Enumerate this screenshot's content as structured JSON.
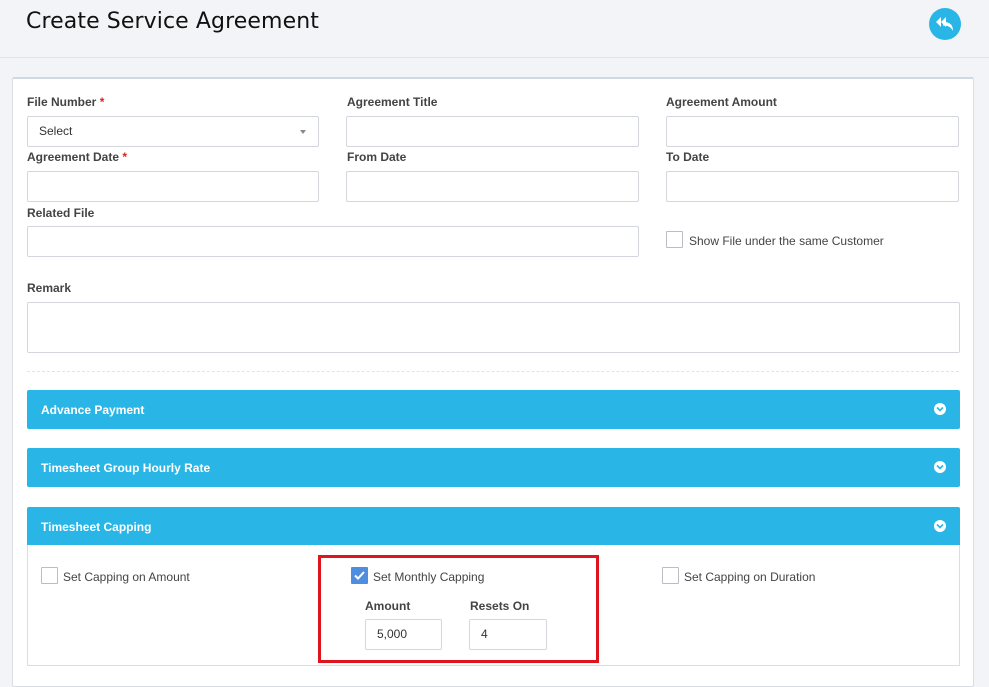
{
  "header": {
    "title": "Create Service Agreement",
    "back_icon": "reply-icon"
  },
  "form": {
    "file_number": {
      "label": "File Number",
      "required_mark": "*",
      "value": "Select"
    },
    "agreement_title": {
      "label": "Agreement Title",
      "value": ""
    },
    "agreement_amount": {
      "label": "Agreement Amount",
      "value": ""
    },
    "agreement_date": {
      "label": "Agreement Date",
      "required_mark": "*",
      "value": ""
    },
    "from_date": {
      "label": "From Date",
      "value": ""
    },
    "to_date": {
      "label": "To Date",
      "value": ""
    },
    "related_file": {
      "label": "Related File",
      "value": ""
    },
    "show_file_same_customer": {
      "label": "Show File under the same Customer",
      "checked": false
    },
    "remark": {
      "label": "Remark",
      "value": ""
    }
  },
  "sections": {
    "advance_payment": {
      "title": "Advance Payment"
    },
    "timesheet_group_hourly_rate": {
      "title": "Timesheet Group Hourly Rate"
    },
    "timesheet_capping": {
      "title": "Timesheet Capping",
      "capping_on_amount": {
        "label": "Set Capping on Amount",
        "checked": false
      },
      "monthly_capping": {
        "label": "Set Monthly Capping",
        "checked": true
      },
      "capping_on_duration": {
        "label": "Set Capping on Duration",
        "checked": false
      },
      "amount": {
        "label": "Amount",
        "value": "5,000"
      },
      "resets_on": {
        "label": "Resets On",
        "value": "4"
      }
    }
  },
  "colors": {
    "accent": "#29b6e6",
    "checkbox_checked": "#4e8de0",
    "required": "#e02020",
    "highlight_box": "#e0141d"
  }
}
